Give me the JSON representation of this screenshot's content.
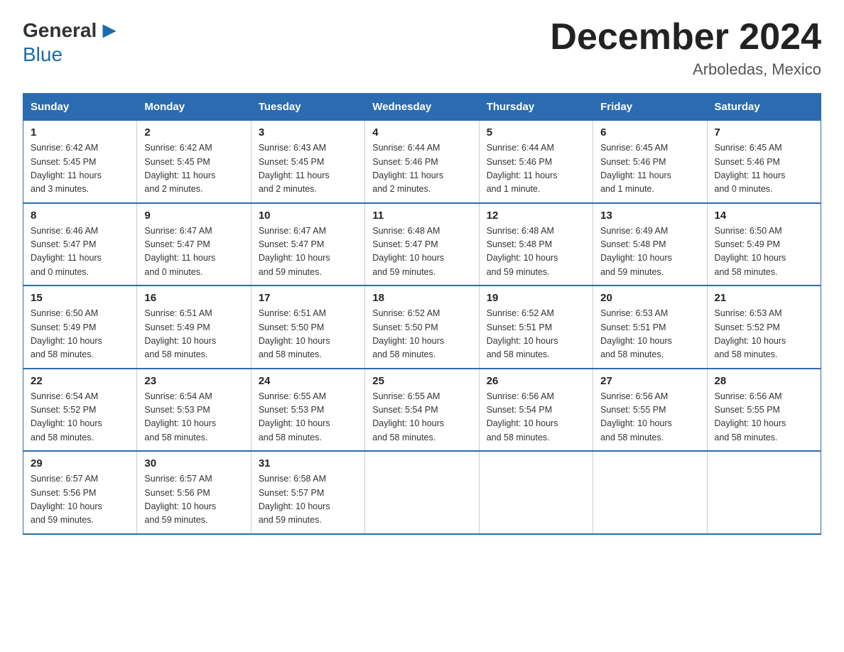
{
  "logo": {
    "general": "General",
    "blue": "Blue"
  },
  "header": {
    "month_year": "December 2024",
    "location": "Arboledas, Mexico"
  },
  "days_of_week": [
    "Sunday",
    "Monday",
    "Tuesday",
    "Wednesday",
    "Thursday",
    "Friday",
    "Saturday"
  ],
  "weeks": [
    [
      {
        "day": "1",
        "sunrise": "6:42 AM",
        "sunset": "5:45 PM",
        "daylight": "11 hours and 3 minutes."
      },
      {
        "day": "2",
        "sunrise": "6:42 AM",
        "sunset": "5:45 PM",
        "daylight": "11 hours and 2 minutes."
      },
      {
        "day": "3",
        "sunrise": "6:43 AM",
        "sunset": "5:45 PM",
        "daylight": "11 hours and 2 minutes."
      },
      {
        "day": "4",
        "sunrise": "6:44 AM",
        "sunset": "5:46 PM",
        "daylight": "11 hours and 2 minutes."
      },
      {
        "day": "5",
        "sunrise": "6:44 AM",
        "sunset": "5:46 PM",
        "daylight": "11 hours and 1 minute."
      },
      {
        "day": "6",
        "sunrise": "6:45 AM",
        "sunset": "5:46 PM",
        "daylight": "11 hours and 1 minute."
      },
      {
        "day": "7",
        "sunrise": "6:45 AM",
        "sunset": "5:46 PM",
        "daylight": "11 hours and 0 minutes."
      }
    ],
    [
      {
        "day": "8",
        "sunrise": "6:46 AM",
        "sunset": "5:47 PM",
        "daylight": "11 hours and 0 minutes."
      },
      {
        "day": "9",
        "sunrise": "6:47 AM",
        "sunset": "5:47 PM",
        "daylight": "11 hours and 0 minutes."
      },
      {
        "day": "10",
        "sunrise": "6:47 AM",
        "sunset": "5:47 PM",
        "daylight": "10 hours and 59 minutes."
      },
      {
        "day": "11",
        "sunrise": "6:48 AM",
        "sunset": "5:47 PM",
        "daylight": "10 hours and 59 minutes."
      },
      {
        "day": "12",
        "sunrise": "6:48 AM",
        "sunset": "5:48 PM",
        "daylight": "10 hours and 59 minutes."
      },
      {
        "day": "13",
        "sunrise": "6:49 AM",
        "sunset": "5:48 PM",
        "daylight": "10 hours and 59 minutes."
      },
      {
        "day": "14",
        "sunrise": "6:50 AM",
        "sunset": "5:49 PM",
        "daylight": "10 hours and 58 minutes."
      }
    ],
    [
      {
        "day": "15",
        "sunrise": "6:50 AM",
        "sunset": "5:49 PM",
        "daylight": "10 hours and 58 minutes."
      },
      {
        "day": "16",
        "sunrise": "6:51 AM",
        "sunset": "5:49 PM",
        "daylight": "10 hours and 58 minutes."
      },
      {
        "day": "17",
        "sunrise": "6:51 AM",
        "sunset": "5:50 PM",
        "daylight": "10 hours and 58 minutes."
      },
      {
        "day": "18",
        "sunrise": "6:52 AM",
        "sunset": "5:50 PM",
        "daylight": "10 hours and 58 minutes."
      },
      {
        "day": "19",
        "sunrise": "6:52 AM",
        "sunset": "5:51 PM",
        "daylight": "10 hours and 58 minutes."
      },
      {
        "day": "20",
        "sunrise": "6:53 AM",
        "sunset": "5:51 PM",
        "daylight": "10 hours and 58 minutes."
      },
      {
        "day": "21",
        "sunrise": "6:53 AM",
        "sunset": "5:52 PM",
        "daylight": "10 hours and 58 minutes."
      }
    ],
    [
      {
        "day": "22",
        "sunrise": "6:54 AM",
        "sunset": "5:52 PM",
        "daylight": "10 hours and 58 minutes."
      },
      {
        "day": "23",
        "sunrise": "6:54 AM",
        "sunset": "5:53 PM",
        "daylight": "10 hours and 58 minutes."
      },
      {
        "day": "24",
        "sunrise": "6:55 AM",
        "sunset": "5:53 PM",
        "daylight": "10 hours and 58 minutes."
      },
      {
        "day": "25",
        "sunrise": "6:55 AM",
        "sunset": "5:54 PM",
        "daylight": "10 hours and 58 minutes."
      },
      {
        "day": "26",
        "sunrise": "6:56 AM",
        "sunset": "5:54 PM",
        "daylight": "10 hours and 58 minutes."
      },
      {
        "day": "27",
        "sunrise": "6:56 AM",
        "sunset": "5:55 PM",
        "daylight": "10 hours and 58 minutes."
      },
      {
        "day": "28",
        "sunrise": "6:56 AM",
        "sunset": "5:55 PM",
        "daylight": "10 hours and 58 minutes."
      }
    ],
    [
      {
        "day": "29",
        "sunrise": "6:57 AM",
        "sunset": "5:56 PM",
        "daylight": "10 hours and 59 minutes."
      },
      {
        "day": "30",
        "sunrise": "6:57 AM",
        "sunset": "5:56 PM",
        "daylight": "10 hours and 59 minutes."
      },
      {
        "day": "31",
        "sunrise": "6:58 AM",
        "sunset": "5:57 PM",
        "daylight": "10 hours and 59 minutes."
      },
      null,
      null,
      null,
      null
    ]
  ],
  "labels": {
    "sunrise": "Sunrise:",
    "sunset": "Sunset:",
    "daylight": "Daylight:"
  }
}
